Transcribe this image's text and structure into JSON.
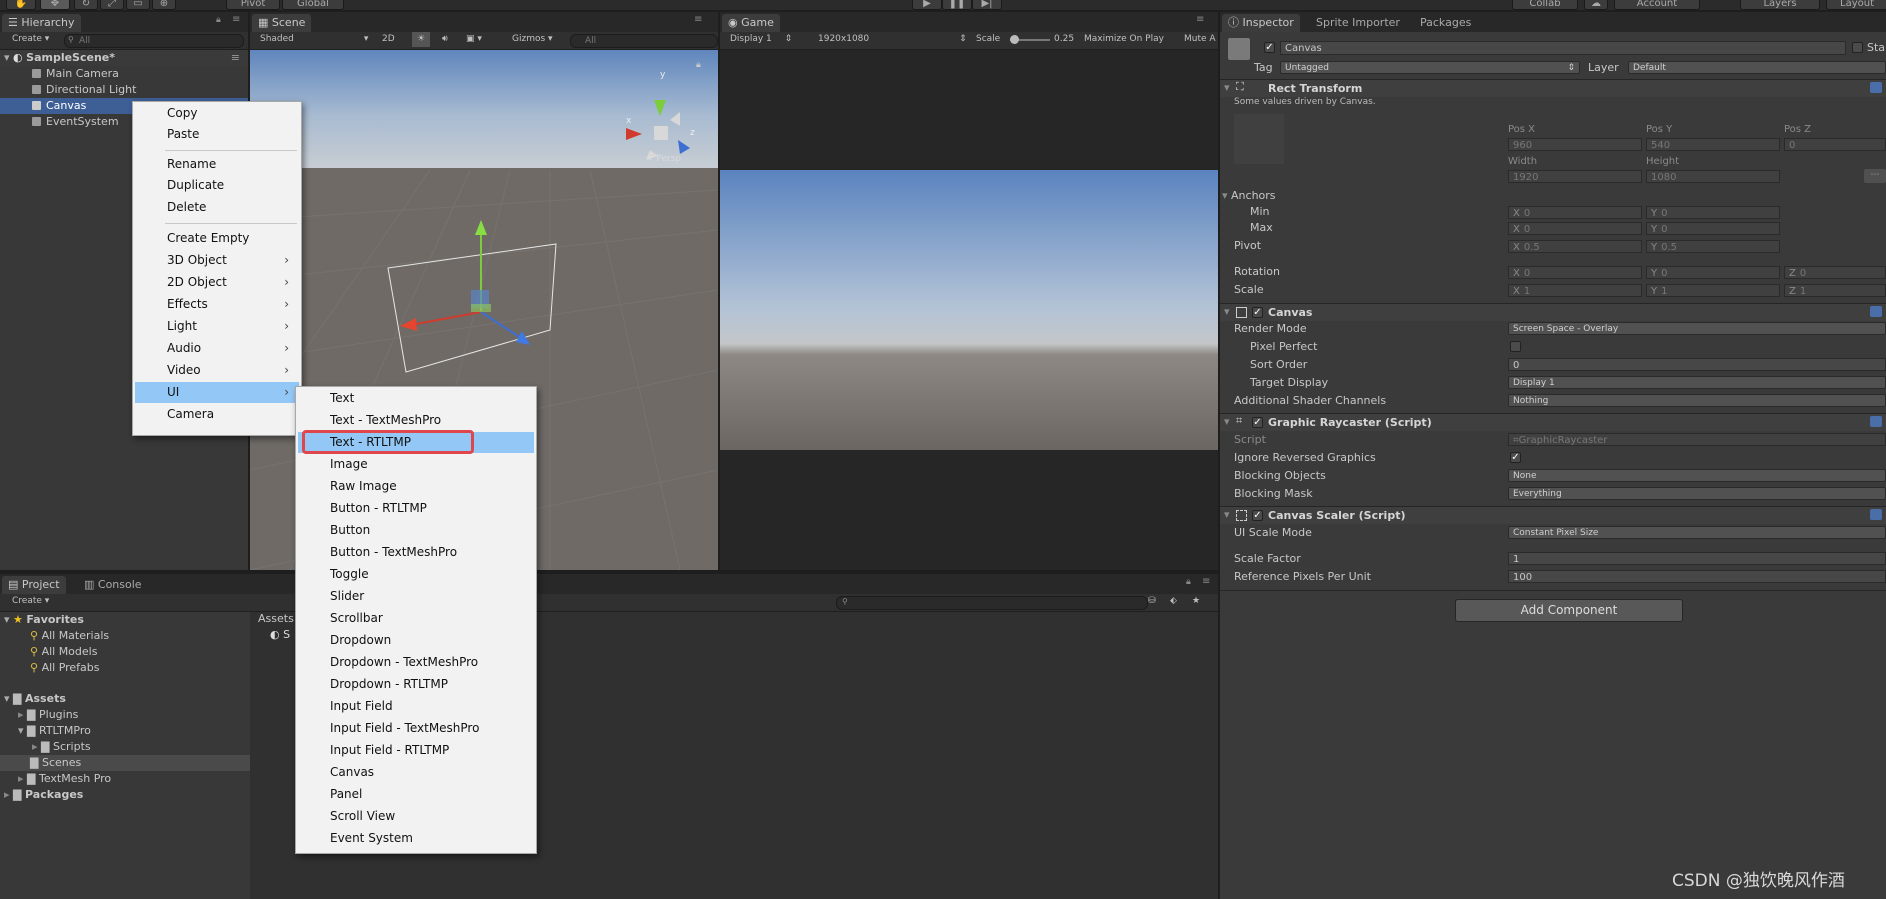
{
  "toolbar": {
    "pivot": "Pivot",
    "global": "Global",
    "collab": "Collab",
    "account": "Account",
    "layers": "Layers",
    "layout": "Layout"
  },
  "hierarchy": {
    "tab": "Hierarchy",
    "create": "Create",
    "search_placeholder": "All",
    "scene": "SampleScene*",
    "items": [
      "Main Camera",
      "Directional Light",
      "Canvas",
      "EventSystem"
    ]
  },
  "scene": {
    "tab": "Scene",
    "shading": "Shaded",
    "mode2d": "2D",
    "gizmos": "Gizmos",
    "search_placeholder": "All",
    "axis_x": "x",
    "axis_y": "y",
    "axis_z": "z",
    "persp": "< Persp"
  },
  "game": {
    "tab": "Game",
    "display": "Display 1",
    "resolution": "1920x1080",
    "scale_label": "Scale",
    "scale_value": "0.25",
    "maximize": "Maximize On Play",
    "mute": "Mute A"
  },
  "context_menu": {
    "items": [
      "Copy",
      "Paste",
      "Rename",
      "Duplicate",
      "Delete",
      "Create Empty",
      "3D Object",
      "2D Object",
      "Effects",
      "Light",
      "Audio",
      "Video",
      "UI",
      "Camera"
    ],
    "arrow": "›"
  },
  "ui_submenu": {
    "items": [
      "Text",
      "Text - TextMeshPro",
      "Text - RTLTMP",
      "Image",
      "Raw Image",
      "Button - RTLTMP",
      "Button",
      "Button - TextMeshPro",
      "Toggle",
      "Slider",
      "Scrollbar",
      "Dropdown",
      "Dropdown - TextMeshPro",
      "Dropdown - RTLTMP",
      "Input Field",
      "Input Field - TextMeshPro",
      "Input Field - RTLTMP",
      "Canvas",
      "Panel",
      "Scroll View",
      "Event System"
    ],
    "highlighted": "Text - RTLTMP"
  },
  "project": {
    "tabs": [
      "Project",
      "Console"
    ],
    "create": "Create",
    "favorites": "Favorites",
    "fav_items": [
      "All Materials",
      "All Models",
      "All Prefabs"
    ],
    "assets": "Assets",
    "asset_items": [
      "Plugins",
      "RTLTMPro",
      "Scripts",
      "Scenes",
      "TextMesh Pro"
    ],
    "packages": "Packages",
    "breadcrumb": "Assets",
    "grid_item": "S"
  },
  "inspector": {
    "tabs": [
      "Inspector",
      "Sprite Importer",
      "Packages"
    ],
    "object_name": "Canvas",
    "static": "Sta",
    "tag_label": "Tag",
    "tag_value": "Untagged",
    "layer_label": "Layer",
    "layer_value": "Default",
    "rect": {
      "title": "Rect Transform",
      "note": "Some values driven by Canvas.",
      "posx_label": "Pos X",
      "posy_label": "Pos Y",
      "posz_label": "Pos Z",
      "posx": "960",
      "posy": "540",
      "posz": "0",
      "width_label": "Width",
      "height_label": "Height",
      "width": "1920",
      "height": "1080",
      "anchors": "Anchors",
      "min": "Min",
      "max": "Max",
      "min_x": "0",
      "min_y": "0",
      "max_x": "0",
      "max_y": "0",
      "pivot": "Pivot",
      "pivot_x": "0.5",
      "pivot_y": "0.5",
      "rotation": "Rotation",
      "rot_x": "0",
      "rot_y": "0",
      "rot_z": "0",
      "scale": "Scale",
      "scale_x": "1",
      "scale_y": "1",
      "scale_z": "1",
      "x": "X",
      "y": "Y",
      "z": "Z"
    },
    "canvas": {
      "title": "Canvas",
      "render_mode_label": "Render Mode",
      "render_mode": "Screen Space - Overlay",
      "pixel_perfect": "Pixel Perfect",
      "sort_order_label": "Sort Order",
      "sort_order": "0",
      "target_display_label": "Target Display",
      "target_display": "Display 1",
      "shader_label": "Additional Shader Channels",
      "shader": "Nothing"
    },
    "raycaster": {
      "title": "Graphic Raycaster (Script)",
      "script_label": "Script",
      "script": "GraphicRaycaster",
      "ignore_label": "Ignore Reversed Graphics",
      "ignore_check": "✓",
      "blocking_objects_label": "Blocking Objects",
      "blocking_objects": "None",
      "blocking_mask_label": "Blocking Mask",
      "blocking_mask": "Everything"
    },
    "scaler": {
      "title": "Canvas Scaler (Script)",
      "mode_label": "UI Scale Mode",
      "mode": "Constant Pixel Size",
      "factor_label": "Scale Factor",
      "factor": "1",
      "ref_label": "Reference Pixels Per Unit",
      "ref": "100"
    },
    "add_component": "Add Component"
  },
  "watermark": "CSDN @独饮晚风作酒",
  "colors": {
    "highlight_box": "#e0474c",
    "menu_highlight": "#93c7f5",
    "selection": "#3e5f96"
  }
}
